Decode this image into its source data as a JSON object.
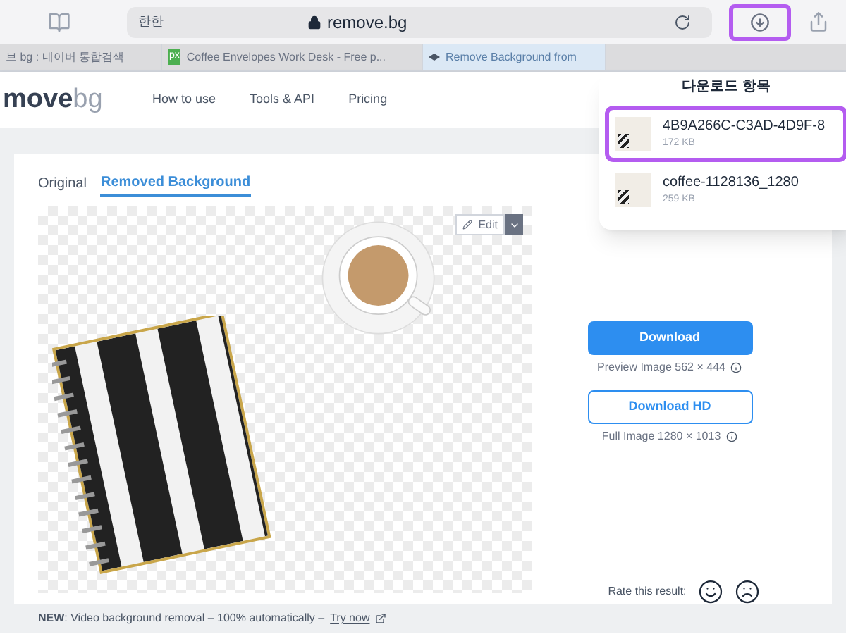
{
  "browser": {
    "reader_label": "한한",
    "url": "remove.bg",
    "downloads_active": true
  },
  "browser_tabs": [
    {
      "title": "브 bg : 네이버 통합검색",
      "selected": false,
      "kind": "plain"
    },
    {
      "title": "Coffee Envelopes Work Desk - Free p...",
      "selected": false,
      "kind": "favicon",
      "favicon_text": "px"
    },
    {
      "title": "Remove Background from",
      "selected": true,
      "kind": "site"
    }
  ],
  "downloads": {
    "title": "다운로드 항목",
    "items": [
      {
        "name": "4B9A266C-C3AD-4D9F-8",
        "size": "172 KB",
        "selected": true
      },
      {
        "name": "coffee-1128136_1280",
        "size": "259 KB",
        "selected": false
      }
    ]
  },
  "site": {
    "logo": "move",
    "logo_suffix": "bg",
    "nav": [
      "How to use",
      "Tools & API",
      "Pricing"
    ]
  },
  "view_tabs": [
    {
      "label": "Original",
      "selected": false
    },
    {
      "label": "Removed Background",
      "selected": true
    }
  ],
  "edit_button": "Edit",
  "download": {
    "label": "Download",
    "note": "Preview Image 562 × 444"
  },
  "download_hd": {
    "label": "Download HD",
    "note": "Full Image 1280 × 1013"
  },
  "rating": {
    "label": "Rate this result:"
  },
  "banner": {
    "text": "**NEW**: Video background removal – 100% automatically –",
    "link": "Try now"
  }
}
